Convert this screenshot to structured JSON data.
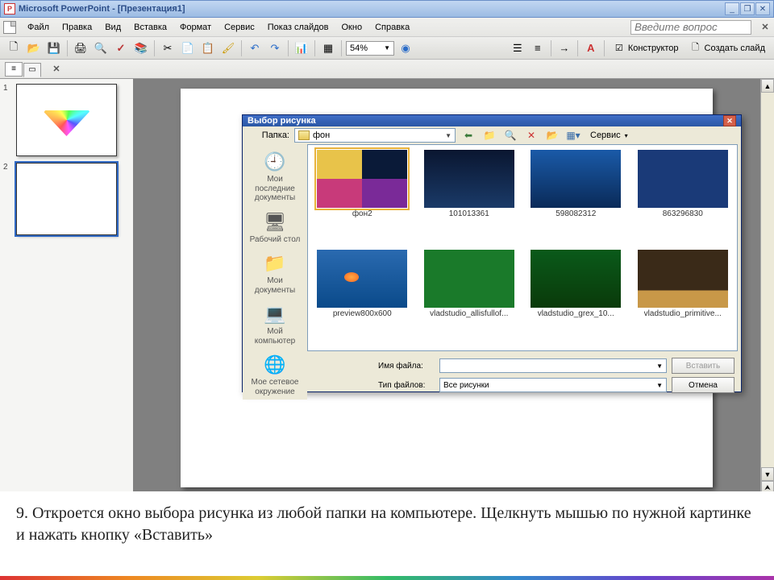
{
  "titlebar": {
    "title": "Microsoft PowerPoint - [Презентация1]"
  },
  "menus": [
    "Файл",
    "Правка",
    "Вид",
    "Вставка",
    "Формат",
    "Сервис",
    "Показ слайдов",
    "Окно",
    "Справка"
  ],
  "askbox_placeholder": "Введите вопрос",
  "zoom": "54%",
  "designer_label": "Конструктор",
  "newslide_label": "Создать слайд",
  "slides": [
    {
      "num": "1"
    },
    {
      "num": "2"
    }
  ],
  "dialog": {
    "title": "Выбор рисунка",
    "folder_label": "Папка:",
    "folder_name": "фон",
    "service_label": "Сервис",
    "places": [
      "Мои последние документы",
      "Рабочий стол",
      "Мои документы",
      "Мой компьютер",
      "Мое сетевое окружение"
    ],
    "files": [
      {
        "name": "фон2"
      },
      {
        "name": "101013361"
      },
      {
        "name": "598082312"
      },
      {
        "name": "863296830"
      },
      {
        "name": "preview800x600"
      },
      {
        "name": "vladstudio_allisfullof..."
      },
      {
        "name": "vladstudio_grex_10..."
      },
      {
        "name": "vladstudio_primitive..."
      }
    ],
    "filename_label": "Имя файла:",
    "filetype_label": "Тип файлов:",
    "filetype_value": "Все рисунки",
    "insert_btn": "Вставить",
    "cancel_btn": "Отмена"
  },
  "caption": "9.   Откроется окно выбора рисунка из любой папки на компьютере. Щелкнуть мышью по нужной картинке и нажать кнопку «Вставить»"
}
